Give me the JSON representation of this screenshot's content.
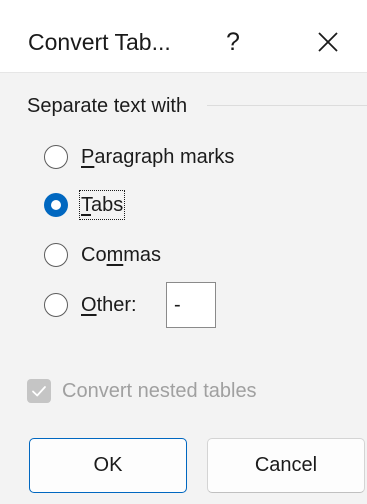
{
  "window": {
    "title": "Convert Tab...",
    "help_label": "?",
    "close_icon": "close-icon"
  },
  "separate_group": {
    "label": "Separate text with",
    "options": [
      {
        "pre": "",
        "u": "P",
        "post": "aragraph marks",
        "checked": false,
        "focused": false
      },
      {
        "pre": "",
        "u": "T",
        "post": "abs",
        "checked": true,
        "focused": true
      },
      {
        "pre": "Co",
        "u": "m",
        "post": "mas",
        "checked": false,
        "focused": false
      },
      {
        "pre": "",
        "u": "O",
        "post": "ther:",
        "checked": false,
        "focused": false
      }
    ],
    "other_value": "-"
  },
  "nested": {
    "label": "Convert nested tables",
    "checked": true,
    "enabled": false
  },
  "buttons": {
    "ok_label": "OK",
    "cancel_label": "Cancel"
  },
  "colors": {
    "accent": "#0067c0",
    "disabled_text": "#a0a0a0",
    "disabled_check": "#c5c5c5"
  }
}
